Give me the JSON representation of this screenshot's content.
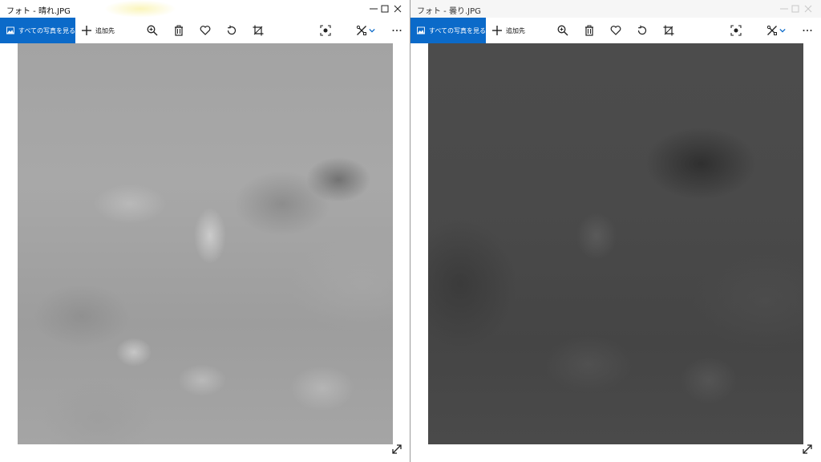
{
  "left_window": {
    "title": "フォト - 晴れ.JPG",
    "toolbar": {
      "see_all_label": "すべての写真を見る",
      "add_to_label": "追加先"
    }
  },
  "right_window": {
    "title": "フォト - 曇り.JPG",
    "toolbar": {
      "see_all_label": "すべての写真を見る",
      "add_to_label": "追加先"
    }
  },
  "colors": {
    "accent": "#0b6ac9",
    "toolbar_icon": "#222222",
    "dropdown_accent": "#0b6ac9"
  },
  "icons": [
    "photos-icon",
    "add-icon",
    "zoom-in-icon",
    "delete-icon",
    "favorite-icon",
    "rotate-icon",
    "crop-icon",
    "enhance-icon",
    "edit-create-icon",
    "chevron-down-icon",
    "more-icon",
    "minimize-icon",
    "maximize-icon",
    "close-icon",
    "expand-icon"
  ]
}
